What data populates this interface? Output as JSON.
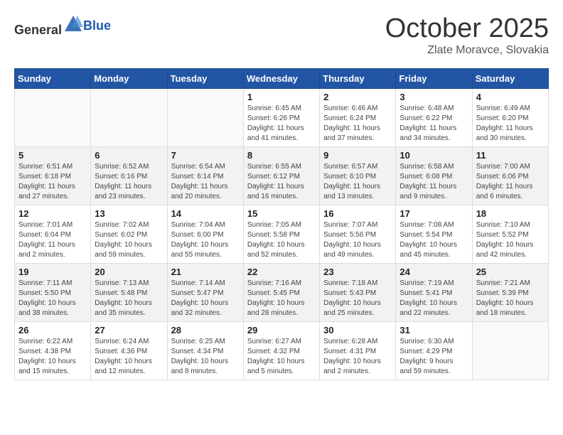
{
  "header": {
    "logo_general": "General",
    "logo_blue": "Blue",
    "month": "October 2025",
    "location": "Zlate Moravce, Slovakia"
  },
  "weekdays": [
    "Sunday",
    "Monday",
    "Tuesday",
    "Wednesday",
    "Thursday",
    "Friday",
    "Saturday"
  ],
  "weeks": [
    {
      "shaded": false,
      "days": [
        {
          "num": "",
          "info": ""
        },
        {
          "num": "",
          "info": ""
        },
        {
          "num": "",
          "info": ""
        },
        {
          "num": "1",
          "info": "Sunrise: 6:45 AM\nSunset: 6:26 PM\nDaylight: 11 hours\nand 41 minutes."
        },
        {
          "num": "2",
          "info": "Sunrise: 6:46 AM\nSunset: 6:24 PM\nDaylight: 11 hours\nand 37 minutes."
        },
        {
          "num": "3",
          "info": "Sunrise: 6:48 AM\nSunset: 6:22 PM\nDaylight: 11 hours\nand 34 minutes."
        },
        {
          "num": "4",
          "info": "Sunrise: 6:49 AM\nSunset: 6:20 PM\nDaylight: 11 hours\nand 30 minutes."
        }
      ]
    },
    {
      "shaded": true,
      "days": [
        {
          "num": "5",
          "info": "Sunrise: 6:51 AM\nSunset: 6:18 PM\nDaylight: 11 hours\nand 27 minutes."
        },
        {
          "num": "6",
          "info": "Sunrise: 6:52 AM\nSunset: 6:16 PM\nDaylight: 11 hours\nand 23 minutes."
        },
        {
          "num": "7",
          "info": "Sunrise: 6:54 AM\nSunset: 6:14 PM\nDaylight: 11 hours\nand 20 minutes."
        },
        {
          "num": "8",
          "info": "Sunrise: 6:55 AM\nSunset: 6:12 PM\nDaylight: 11 hours\nand 16 minutes."
        },
        {
          "num": "9",
          "info": "Sunrise: 6:57 AM\nSunset: 6:10 PM\nDaylight: 11 hours\nand 13 minutes."
        },
        {
          "num": "10",
          "info": "Sunrise: 6:58 AM\nSunset: 6:08 PM\nDaylight: 11 hours\nand 9 minutes."
        },
        {
          "num": "11",
          "info": "Sunrise: 7:00 AM\nSunset: 6:06 PM\nDaylight: 11 hours\nand 6 minutes."
        }
      ]
    },
    {
      "shaded": false,
      "days": [
        {
          "num": "12",
          "info": "Sunrise: 7:01 AM\nSunset: 6:04 PM\nDaylight: 11 hours\nand 2 minutes."
        },
        {
          "num": "13",
          "info": "Sunrise: 7:02 AM\nSunset: 6:02 PM\nDaylight: 10 hours\nand 59 minutes."
        },
        {
          "num": "14",
          "info": "Sunrise: 7:04 AM\nSunset: 6:00 PM\nDaylight: 10 hours\nand 55 minutes."
        },
        {
          "num": "15",
          "info": "Sunrise: 7:05 AM\nSunset: 5:58 PM\nDaylight: 10 hours\nand 52 minutes."
        },
        {
          "num": "16",
          "info": "Sunrise: 7:07 AM\nSunset: 5:56 PM\nDaylight: 10 hours\nand 49 minutes."
        },
        {
          "num": "17",
          "info": "Sunrise: 7:08 AM\nSunset: 5:54 PM\nDaylight: 10 hours\nand 45 minutes."
        },
        {
          "num": "18",
          "info": "Sunrise: 7:10 AM\nSunset: 5:52 PM\nDaylight: 10 hours\nand 42 minutes."
        }
      ]
    },
    {
      "shaded": true,
      "days": [
        {
          "num": "19",
          "info": "Sunrise: 7:11 AM\nSunset: 5:50 PM\nDaylight: 10 hours\nand 38 minutes."
        },
        {
          "num": "20",
          "info": "Sunrise: 7:13 AM\nSunset: 5:48 PM\nDaylight: 10 hours\nand 35 minutes."
        },
        {
          "num": "21",
          "info": "Sunrise: 7:14 AM\nSunset: 5:47 PM\nDaylight: 10 hours\nand 32 minutes."
        },
        {
          "num": "22",
          "info": "Sunrise: 7:16 AM\nSunset: 5:45 PM\nDaylight: 10 hours\nand 28 minutes."
        },
        {
          "num": "23",
          "info": "Sunrise: 7:18 AM\nSunset: 5:43 PM\nDaylight: 10 hours\nand 25 minutes."
        },
        {
          "num": "24",
          "info": "Sunrise: 7:19 AM\nSunset: 5:41 PM\nDaylight: 10 hours\nand 22 minutes."
        },
        {
          "num": "25",
          "info": "Sunrise: 7:21 AM\nSunset: 5:39 PM\nDaylight: 10 hours\nand 18 minutes."
        }
      ]
    },
    {
      "shaded": false,
      "days": [
        {
          "num": "26",
          "info": "Sunrise: 6:22 AM\nSunset: 4:38 PM\nDaylight: 10 hours\nand 15 minutes."
        },
        {
          "num": "27",
          "info": "Sunrise: 6:24 AM\nSunset: 4:36 PM\nDaylight: 10 hours\nand 12 minutes."
        },
        {
          "num": "28",
          "info": "Sunrise: 6:25 AM\nSunset: 4:34 PM\nDaylight: 10 hours\nand 8 minutes."
        },
        {
          "num": "29",
          "info": "Sunrise: 6:27 AM\nSunset: 4:32 PM\nDaylight: 10 hours\nand 5 minutes."
        },
        {
          "num": "30",
          "info": "Sunrise: 6:28 AM\nSunset: 4:31 PM\nDaylight: 10 hours\nand 2 minutes."
        },
        {
          "num": "31",
          "info": "Sunrise: 6:30 AM\nSunset: 4:29 PM\nDaylight: 9 hours\nand 59 minutes."
        },
        {
          "num": "",
          "info": ""
        }
      ]
    }
  ]
}
